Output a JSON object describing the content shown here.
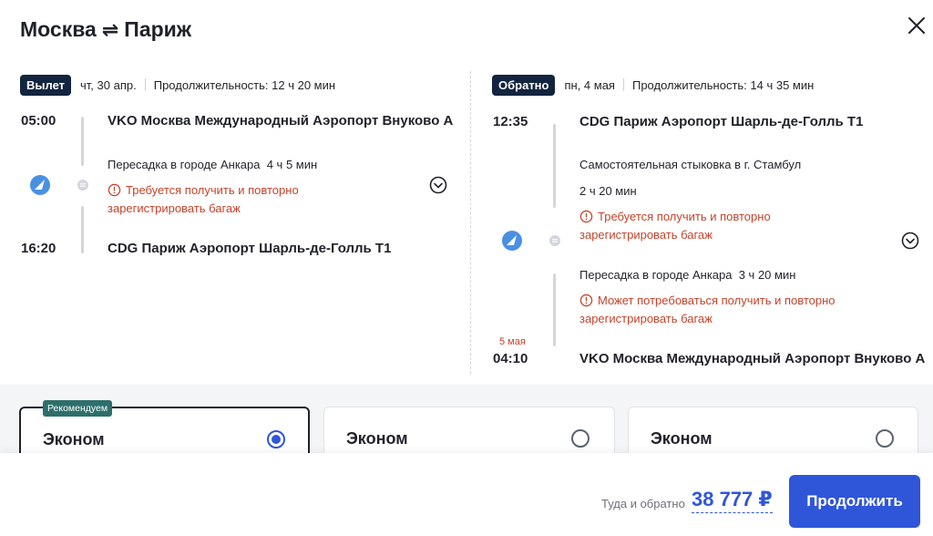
{
  "route": {
    "from": "Москва",
    "to": "Париж"
  },
  "outbound": {
    "badge": "Вылет",
    "date": "чт, 30 апр.",
    "duration": "Продолжительность: 12 ч 20 мин",
    "dep_time": "05:00",
    "dep_airport": "VKO Москва Международный Аэропорт Внуково А",
    "transfer": "Пересадка в городе Анкара",
    "transfer_duration": "4 ч 5 мин",
    "warning_line1": "Требуется получить и повторно",
    "warning_line2": "зарегистрировать багаж",
    "arr_time": "16:20",
    "arr_airport": "CDG Париж Аэропорт Шарль-де-Голль Т1"
  },
  "return": {
    "badge": "Обратно",
    "date": "пн, 4 мая",
    "duration": "Продолжительность: 14 ч 35 мин",
    "dep_time": "12:35",
    "dep_airport": "CDG Париж Аэропорт Шарль-де-Голль Т1",
    "connection": "Самостоятельная стыковка в г. Стамбул",
    "connection_duration": "2 ч 20 мин",
    "warning1_line1": "Требуется получить и повторно",
    "warning1_line2": "зарегистрировать багаж",
    "transfer": "Пересадка в городе Анкара",
    "transfer_duration": "3 ч 20 мин",
    "warning2_line1": "Может потребоваться получить и повторно",
    "warning2_line2": "зарегистрировать багаж",
    "arr_date": "5 мая",
    "arr_time": "04:10",
    "arr_airport": "VKO Москва Международный Аэропорт Внуково А"
  },
  "fares": [
    {
      "name": "Эконом",
      "recommended": "Рекомендуем",
      "selected": true
    },
    {
      "name": "Эконом",
      "selected": false
    },
    {
      "name": "Эконом",
      "selected": false
    }
  ],
  "footer": {
    "total_label": "Туда и обратно",
    "total_price": "38 777 ₽",
    "continue_label": "Продолжить"
  },
  "colors": {
    "accent": "#2f56d8",
    "warning": "#c4432a",
    "badge_dark": "#13243f",
    "recommended": "#2d6f6b",
    "airline_logo": "#4a90e2"
  },
  "icons": {
    "route_swap": "swap-arrows-icon",
    "close": "close-icon",
    "airline": "airline-logo-icon",
    "stop": "stop-dot-icon",
    "warning": "warning-circle-icon",
    "expand": "chevron-down-icon"
  }
}
